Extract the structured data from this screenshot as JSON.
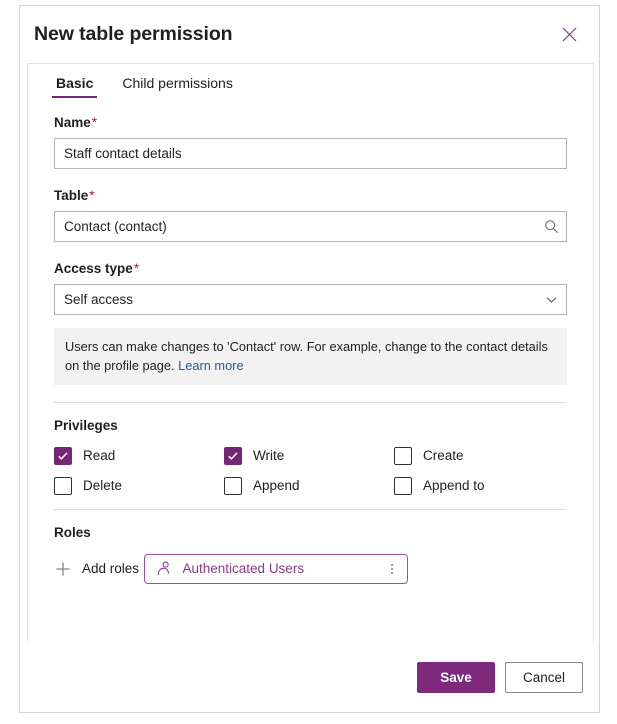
{
  "panel": {
    "title": "New table permission",
    "close_icon": "close-icon"
  },
  "tabs": [
    {
      "label": "Basic",
      "active": true
    },
    {
      "label": "Child permissions",
      "active": false
    }
  ],
  "form": {
    "name": {
      "label": "Name",
      "required_marker": "*",
      "value": "Staff contact details"
    },
    "table": {
      "label": "Table",
      "required_marker": "*",
      "value": "Contact (contact)",
      "icon": "search-icon"
    },
    "access_type": {
      "label": "Access type",
      "required_marker": "*",
      "value": "Self access",
      "icon": "chevron-down-icon"
    },
    "info": {
      "text": "Users can make changes to 'Contact' row. For example, change to the contact details on the profile page. ",
      "link_text": "Learn more"
    }
  },
  "privileges": {
    "title": "Privileges",
    "items": [
      {
        "label": "Read",
        "checked": true
      },
      {
        "label": "Write",
        "checked": true
      },
      {
        "label": "Create",
        "checked": false
      },
      {
        "label": "Delete",
        "checked": false
      },
      {
        "label": "Append",
        "checked": false
      },
      {
        "label": "Append to",
        "checked": false
      }
    ]
  },
  "roles": {
    "title": "Roles",
    "add_label": "Add roles",
    "add_icon": "plus-icon",
    "chips": [
      {
        "label": "Authenticated Users",
        "icon": "person-icon",
        "menu_icon": "more-vertical-icon"
      }
    ]
  },
  "footer": {
    "save_label": "Save",
    "cancel_label": "Cancel"
  },
  "colors": {
    "accent": "#742774",
    "primary_button": "#7d2a7d",
    "chip_border": "#a04fa0",
    "chip_text": "#8a3a8a",
    "required": "#a4262c",
    "link": "#2b579a",
    "info_bg": "#f2f2f2"
  }
}
